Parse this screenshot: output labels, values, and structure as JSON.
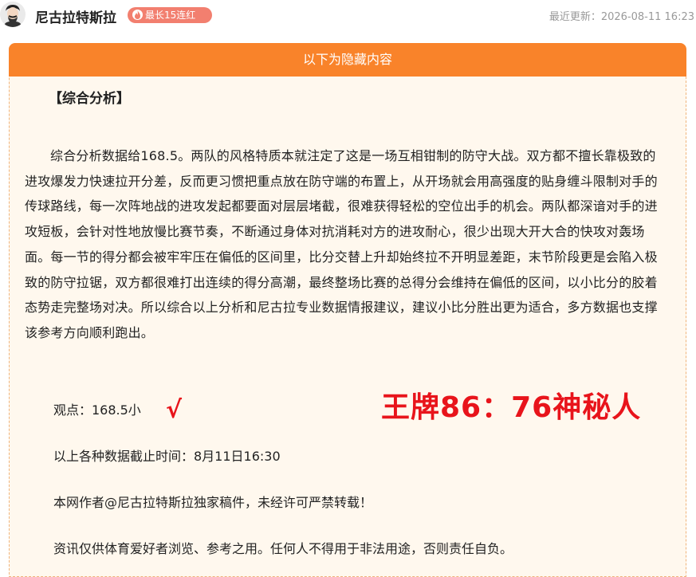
{
  "header": {
    "author": "尼古拉特斯拉",
    "badge": "最长15连红",
    "updated": "最近更新：2026-08-11 16:23"
  },
  "panel": {
    "title": "以下为隐藏内容",
    "section_title": "【综合分析】",
    "paragraph": "综合分析数据给168.5。两队的风格特质本就注定了这是一场互相钳制的防守大战。双方都不擅长靠极致的进攻爆发力快速拉开分差，反而更习惯把重点放在防守端的布置上，从开场就会用高强度的贴身缠斗限制对手的传球路线，每一次阵地战的进攻发起都要面对层层堵截，很难获得轻松的空位出手的机会。两队都深谙对手的进攻短板，会针对性地放慢比赛节奏，不断通过身体对抗消耗对方的进攻耐心，很少出现大开大合的快攻对轰场面。每一节的得分都会被牢牢压在偏低的区间里，比分交替上升却始终拉不开明显差距，末节阶段更是会陷入极致的防守拉锯，双方都很难打出连续的得分高潮，最终整场比赛的总得分会维持在偏低的区间，以小比分的胶着态势走完整场对决。所以综合以上分析和尼古拉专业数据情报建议，建议小比分胜出更为适合，多方数据也支撑该参考方向顺利跑出。",
    "viewpoint": "观点：168.5小",
    "check_mark": "√",
    "promo": "王牌86：76神秘人",
    "deadline": "以上各种数据截止时间：8月11日16:30",
    "copyright": "本网作者@尼古拉特斯拉独家稿件，未经许可严禁转载！",
    "disclaimer": "资讯仅供体育爱好者浏览、参考之用。任何人不得用于非法用途，否则责任自负。"
  },
  "colors": {
    "accent": "#f9832a",
    "badge": "#f27f6f",
    "promo": "#e8141b",
    "panel_bg": "#fff8ee"
  },
  "icons": [
    "author-avatar",
    "flame-icon"
  ]
}
